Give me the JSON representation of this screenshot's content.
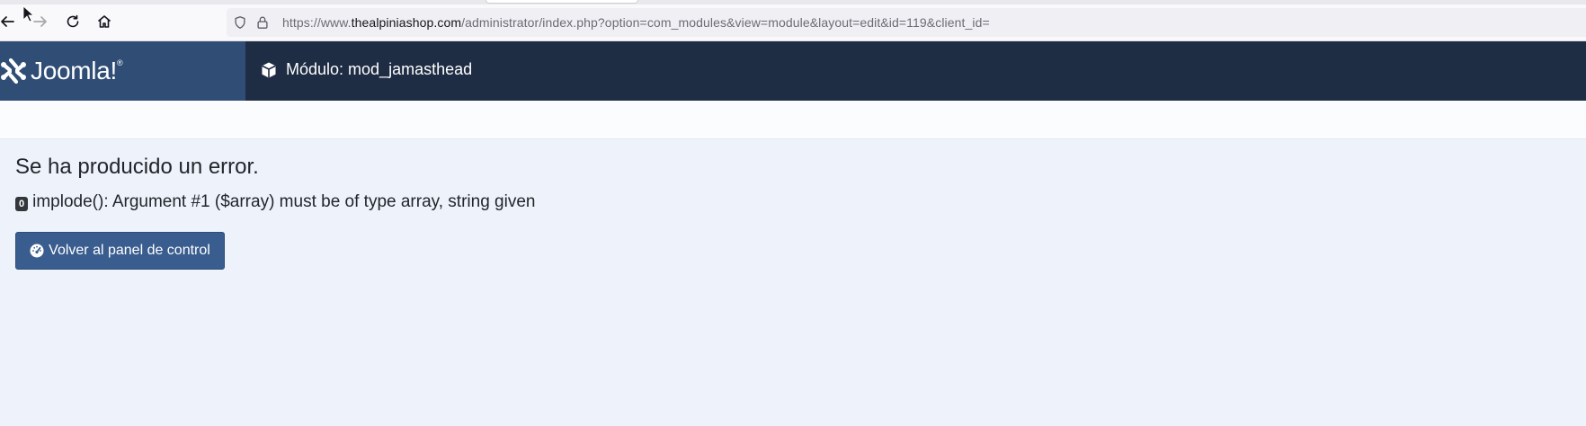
{
  "browser": {
    "url_prefix": "https://www.",
    "url_host": "thealpiniashop.com",
    "url_path": "/administrator/index.php?option=com_modules&view=module&layout=edit&id=119&client_id="
  },
  "header": {
    "logo_text": "Joomla!",
    "logo_mark": "®",
    "title": "Módulo: mod_jamasthead",
    "title_icon": "cube-icon"
  },
  "error": {
    "heading": "Se ha producido un error.",
    "code": "0",
    "message": "implode(): Argument #1 ($array) must be of type array, string given"
  },
  "actions": {
    "back_label": "Volver al panel de control",
    "back_icon": "dashboard-gauge-icon"
  },
  "colors": {
    "header_bg": "#1f2d44",
    "logo_bg": "#2f4d75",
    "content_bg": "#eef3fb",
    "button_bg": "#3a5d8f"
  }
}
